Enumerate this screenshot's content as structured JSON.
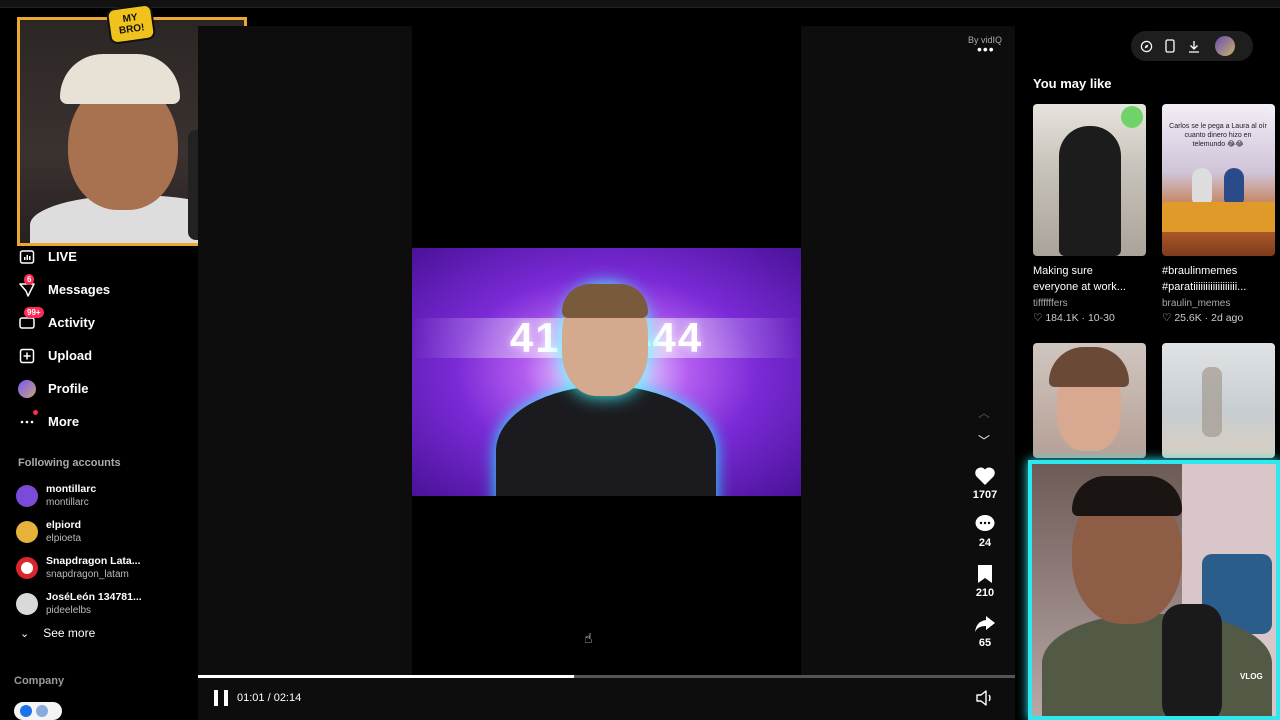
{
  "sidebar": {
    "nav": [
      {
        "label": "LIVE",
        "icon": "live-icon"
      },
      {
        "label": "Messages",
        "icon": "messages-icon",
        "badge": "6"
      },
      {
        "label": "Activity",
        "icon": "activity-icon",
        "badge": "99+"
      },
      {
        "label": "Upload",
        "icon": "upload-icon"
      },
      {
        "label": "Profile",
        "icon": "profile-avatar"
      },
      {
        "label": "More",
        "icon": "more-icon"
      }
    ],
    "following_title": "Following accounts",
    "following": [
      {
        "name": "montillarc",
        "handle": "montillarc",
        "color": "#7b4ad9"
      },
      {
        "name": "elpiord",
        "handle": "elpioeta",
        "color": "#e7b23a"
      },
      {
        "name": "Snapdragon Lata...",
        "handle": "snapdragon_latam",
        "color": "#d7262e"
      },
      {
        "name": "JoséLeón 134781...",
        "handle": "pideelelbs",
        "color": "#d9d9d9"
      }
    ],
    "see_more": "See more",
    "company": "Company"
  },
  "webcam_logo": {
    "line1": "MY",
    "line2": "BRO!"
  },
  "player": {
    "by_label": "By vidIQ",
    "thumbnail_text": "419,      ,444",
    "likes": "1707",
    "comments": "24",
    "saves": "210",
    "shares": "65",
    "progress": 0.46,
    "time": "01:01 / 02:14"
  },
  "recommendations": {
    "title": "You may like",
    "items": [
      {
        "title_line1": "Making sure",
        "title_line2": "everyone at work...",
        "author": "tiffffffers",
        "meta": "♡ 184.1K · 10-30"
      },
      {
        "title_line1": "#braulinmemes",
        "title_line2": "#paratiiiiiiiiiiiiiiiiii...",
        "author": "braulin_memes",
        "meta": "♡ 25.6K · 2d ago",
        "overlay": "Carlos se le pega a Laura al oír cuanto dinero hizo en telemundo 😂😂"
      }
    ]
  },
  "colors": {
    "accent": "#fe2c55",
    "cam_border_top": "#e9a834",
    "cam_border_bottom": "#2ee8f0"
  },
  "watermark": "VLOG"
}
